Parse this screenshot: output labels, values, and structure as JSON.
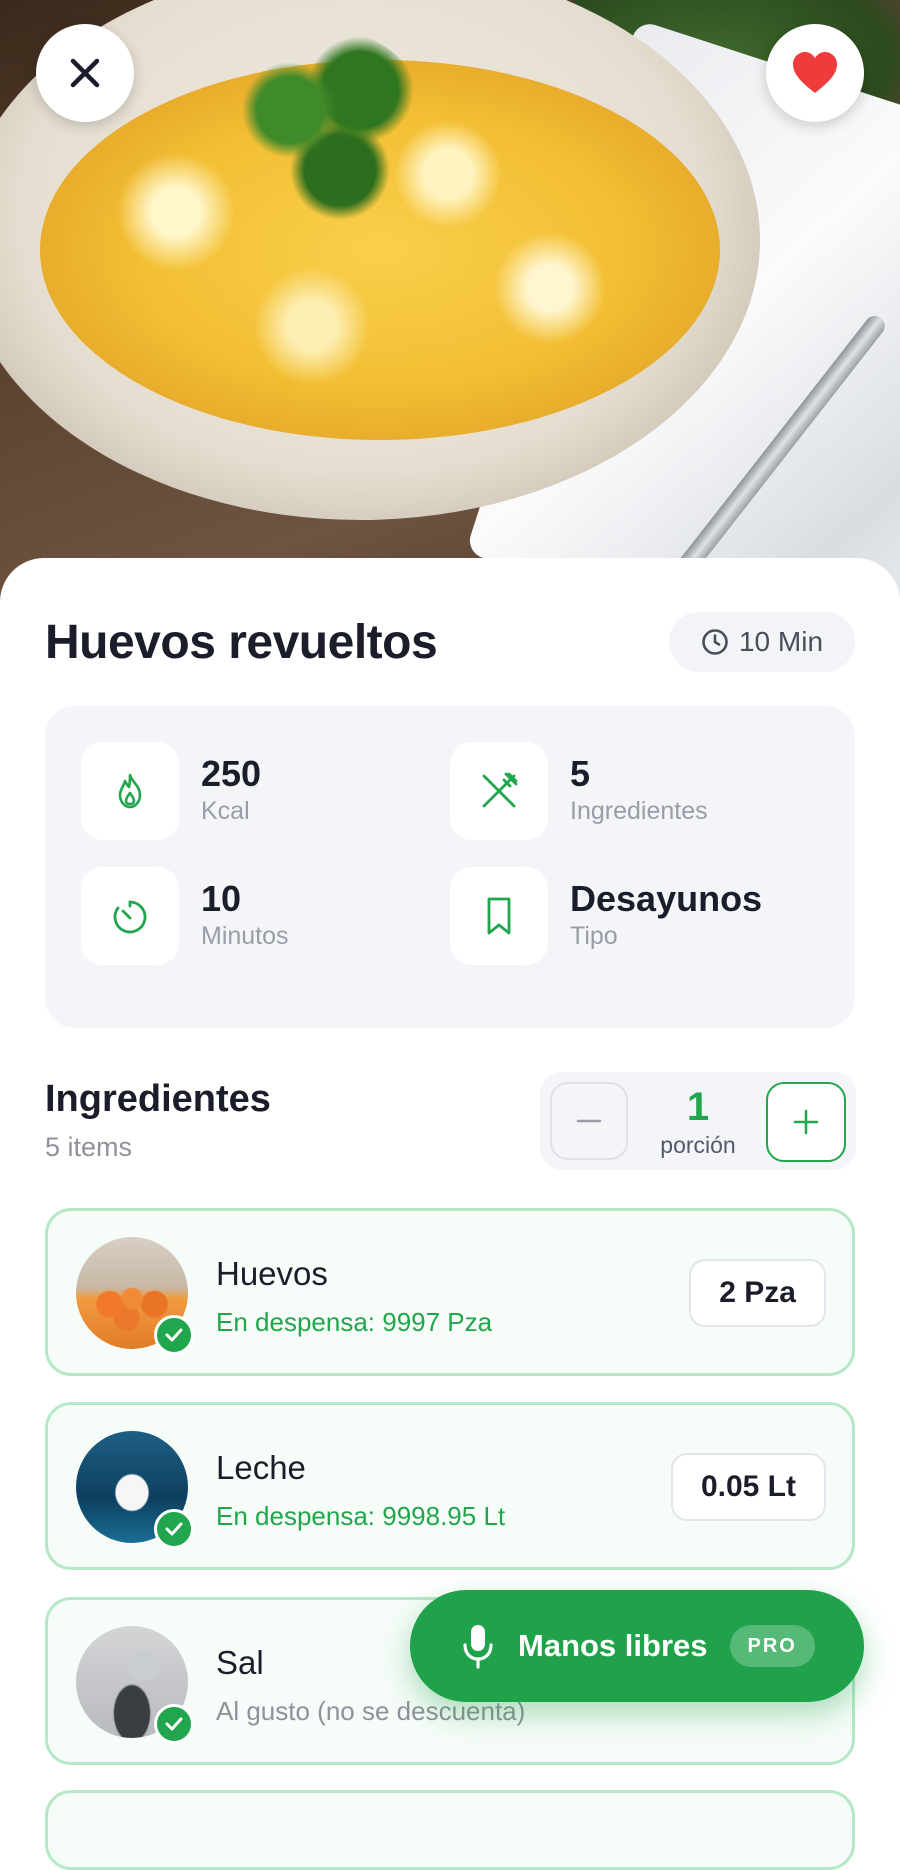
{
  "recipe": {
    "title": "Huevos revueltos",
    "time_chip": "10 Min",
    "favorite": true
  },
  "stats": [
    {
      "value": "250",
      "label": "Kcal",
      "icon": "flame-icon"
    },
    {
      "value": "5",
      "label": "Ingredientes",
      "icon": "fork-knife-icon"
    },
    {
      "value": "10",
      "label": "Minutos",
      "icon": "timer-icon"
    },
    {
      "value": "Desayunos",
      "label": "Tipo",
      "icon": "bookmark-icon"
    }
  ],
  "ingredients_section": {
    "title": "Ingredientes",
    "count": "5 items",
    "servings": {
      "value": "1",
      "unit": "porción"
    }
  },
  "ingredients": [
    {
      "name": "Huevos",
      "stock": "En despensa: 9997 Pza",
      "qty": "2 Pza",
      "in_pantry": true
    },
    {
      "name": "Leche",
      "stock": "En despensa: 9998.95 Lt",
      "qty": "0.05 Lt",
      "in_pantry": true
    },
    {
      "name": "Sal",
      "stock": "Al gusto (no se descuenta)",
      "qty": "",
      "in_pantry": true
    }
  ],
  "fab": {
    "label": "Manos libres",
    "badge": "PRO"
  },
  "colors": {
    "accent": "#22a64d",
    "card_border": "#b5e8c6",
    "fav": "#ef3b3b"
  }
}
